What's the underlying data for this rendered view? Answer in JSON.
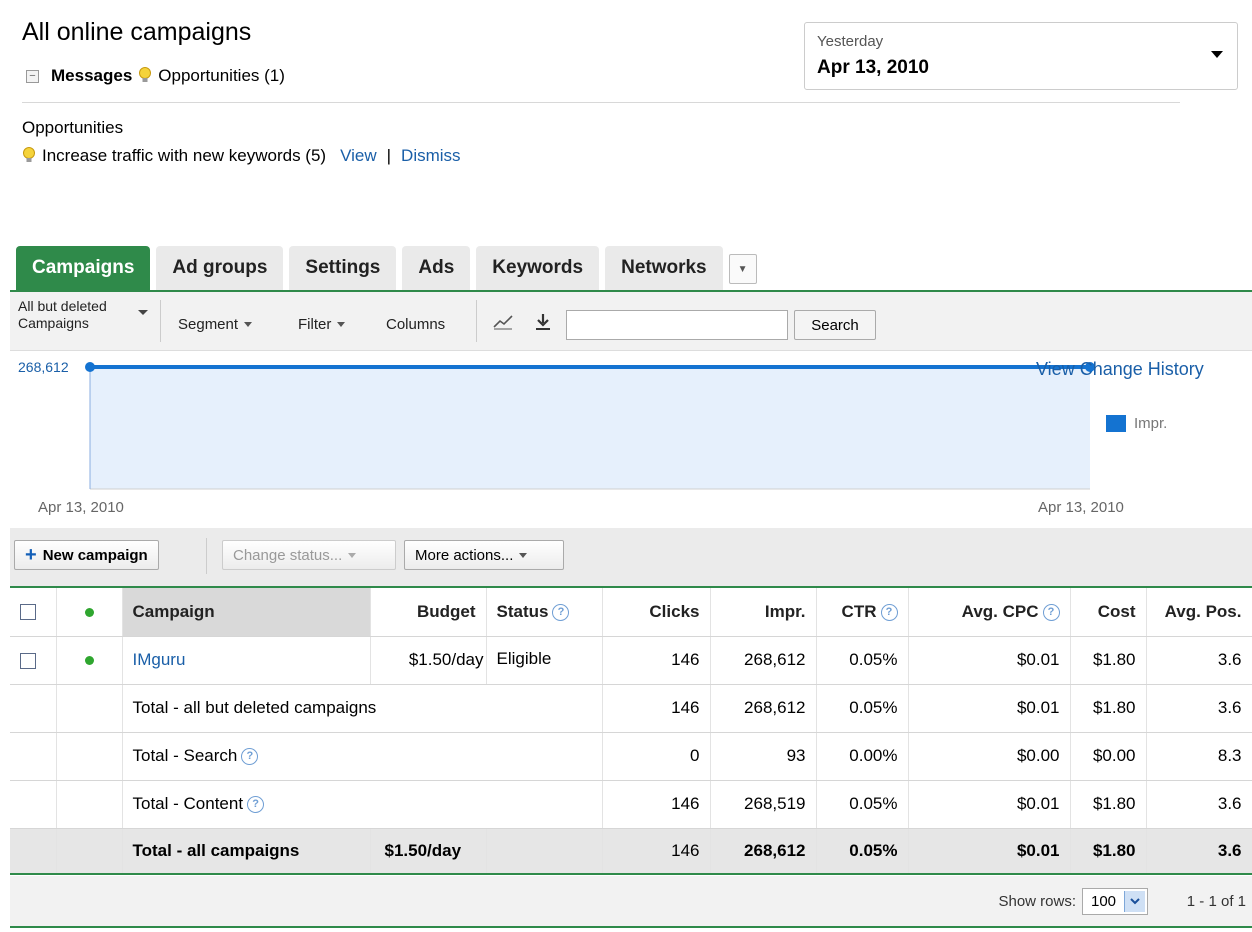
{
  "header": {
    "title": "All online campaigns",
    "messages_label": "Messages",
    "opportunities_link": "Opportunities (1)"
  },
  "date_range": {
    "label": "Yesterday",
    "value": "Apr 13, 2010"
  },
  "opportunities": {
    "title": "Opportunities",
    "text": "Increase traffic with new keywords (5)",
    "view": "View",
    "separator": "|",
    "dismiss": "Dismiss"
  },
  "tabs": [
    {
      "label": "Campaigns",
      "active": true
    },
    {
      "label": "Ad groups"
    },
    {
      "label": "Settings"
    },
    {
      "label": "Ads"
    },
    {
      "label": "Keywords"
    },
    {
      "label": "Networks"
    }
  ],
  "toolbar": {
    "filter_line1": "All but deleted",
    "filter_line2": "Campaigns",
    "segment": "Segment",
    "filter": "Filter",
    "columns": "Columns",
    "search_value": "",
    "search_button": "Search"
  },
  "chart_data": {
    "type": "area",
    "x": [
      "Apr 13, 2010",
      "Apr 13, 2010"
    ],
    "series": [
      {
        "name": "Impr.",
        "values": [
          268612,
          268612
        ]
      }
    ],
    "max_label": "268,612",
    "x_start_label": "Apr 13, 2010",
    "x_end_label": "Apr 13, 2010",
    "legend": "Impr.",
    "legend_position": "right",
    "color": "#1473d1",
    "fill": "#e6f0fc"
  },
  "chart_link": "View Change History",
  "actions": {
    "new_campaign": "New campaign",
    "change_status": "Change status...",
    "more_actions": "More actions..."
  },
  "table": {
    "headers": {
      "campaign": "Campaign",
      "budget": "Budget",
      "status": "Status",
      "clicks": "Clicks",
      "impr": "Impr.",
      "ctr": "CTR",
      "avg_cpc": "Avg. CPC",
      "cost": "Cost",
      "avg_pos": "Avg. Pos."
    },
    "campaign": {
      "name": "IMguru",
      "budget": "$1.50/day",
      "status": "Eligible",
      "clicks": "146",
      "impr": "268,612",
      "ctr": "0.05%",
      "avg_cpc": "$0.01",
      "cost": "$1.80",
      "avg_pos": "3.6"
    },
    "total_deleted": {
      "label": "Total - all but deleted campaigns",
      "clicks": "146",
      "impr": "268,612",
      "ctr": "0.05%",
      "avg_cpc": "$0.01",
      "cost": "$1.80",
      "avg_pos": "3.6"
    },
    "total_search": {
      "label": "Total - Search",
      "clicks": "0",
      "impr": "93",
      "ctr": "0.00%",
      "avg_cpc": "$0.00",
      "cost": "$0.00",
      "avg_pos": "8.3"
    },
    "total_content": {
      "label": "Total - Content",
      "clicks": "146",
      "impr": "268,519",
      "ctr": "0.05%",
      "avg_cpc": "$0.01",
      "cost": "$1.80",
      "avg_pos": "3.6"
    },
    "total_all": {
      "label": "Total - all campaigns",
      "budget": "$1.50/day",
      "clicks": "146",
      "impr": "268,612",
      "ctr": "0.05%",
      "avg_cpc": "$0.01",
      "cost": "$1.80",
      "avg_pos": "3.6"
    }
  },
  "footer": {
    "show_rows_label": "Show rows:",
    "rows_value": "100",
    "range": "1 - 1 of 1"
  },
  "icons": {
    "help": "?"
  }
}
